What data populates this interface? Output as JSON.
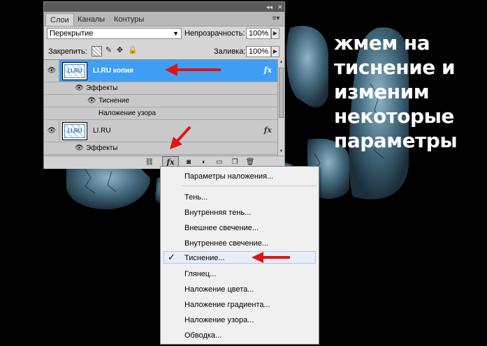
{
  "caption": [
    "жмем на",
    "тиснение и",
    "изменим",
    "некоторые",
    "параметры"
  ],
  "panel": {
    "tabs": [
      "Слои",
      "Каналы",
      "Контуры"
    ],
    "blend_mode": "Перекрытие",
    "opacity_label": "Непрозрачность:",
    "opacity_value": "100%",
    "lock_label": "Закрепить:",
    "fill_label": "Заливка:",
    "fill_value": "100%",
    "layers": [
      {
        "name": "LI.RU копия",
        "selected": true,
        "thumb_text": "LI.RU"
      },
      {
        "name": "LI.RU",
        "selected": false,
        "thumb_text": "LI.RU"
      }
    ],
    "effects_label": "Эффекты",
    "effect_items": [
      "Тиснение",
      "Наложение узора"
    ],
    "effects_label_2": "Эффекты",
    "fx_glyph": "fx"
  },
  "menu": {
    "items": [
      "Параметры наложения...",
      "Тень...",
      "Внутренняя тень...",
      "Внешнее свечение...",
      "Внутреннее свечение...",
      "Тиснение...",
      "Глянец...",
      "Наложение цвета...",
      "Наложение градиента...",
      "Наложение узора...",
      "Обводка..."
    ],
    "checked_item": "Тиснение..."
  },
  "colors": {
    "selection": "#3f9ff5",
    "arrow": "#e41313",
    "menu_bg": "#f0f0f0"
  }
}
